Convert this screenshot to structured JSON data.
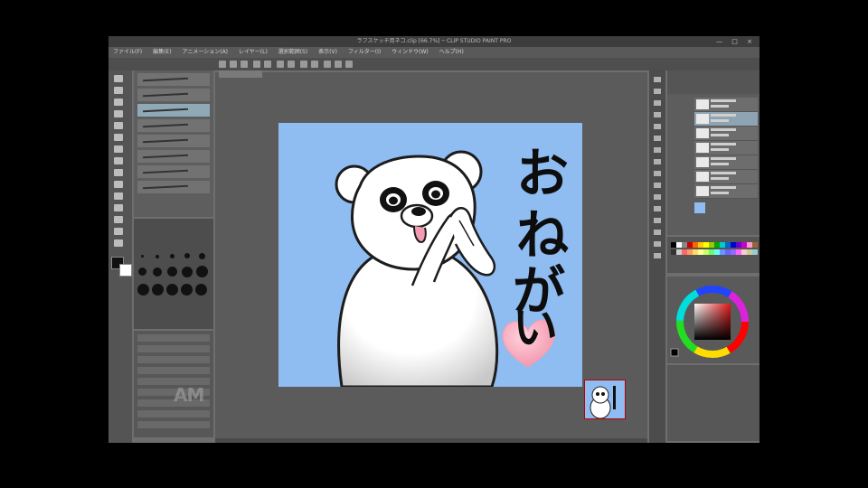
{
  "window": {
    "title": "ラフスケッチ用ネコ.clip [66.7%] ─ CLIP STUDIO PAINT PRO",
    "controls": "—  □  ×"
  },
  "menu": [
    "ファイル(F)",
    "編集(E)",
    "アニメーション(A)",
    "レイヤー(L)",
    "選択範囲(S)",
    "表示(V)",
    "フィルター(I)",
    "ウィンドウ(W)",
    "ヘルプ(H)"
  ],
  "watermark": "AM",
  "artwork": {
    "lettering": "おねがい",
    "background_color": "#8fbcf1",
    "heart_color": "#f6a6b8"
  },
  "colors": {
    "accent": "#8fa9b6",
    "panel": "#5e5e5e"
  },
  "icons": [
    "pen-tool-icon",
    "eraser-icon",
    "fill-icon",
    "eyedropper-icon",
    "color-wheel-icon",
    "layer-visibility-icon"
  ]
}
